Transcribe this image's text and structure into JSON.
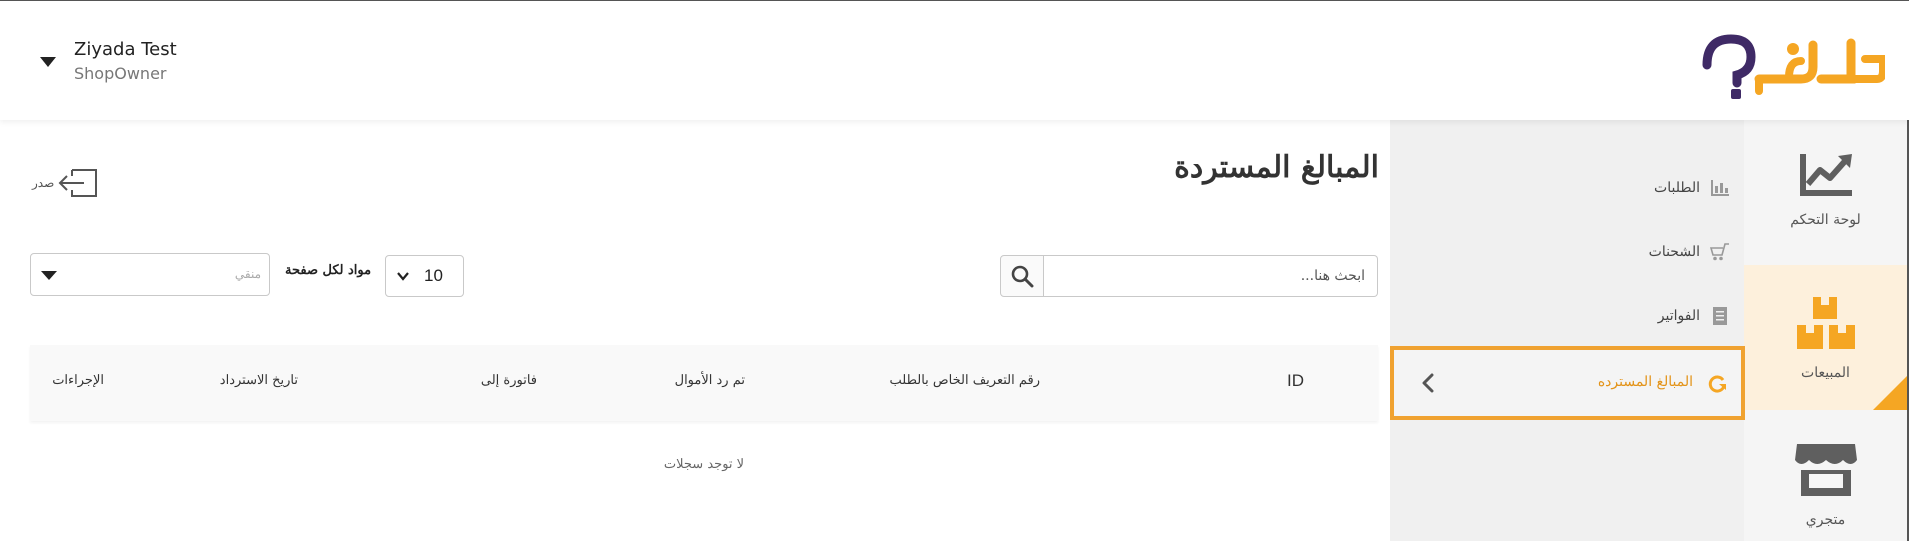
{
  "header": {
    "user_name": "Ziyada Test",
    "user_role": "ShopOwner",
    "logo_text": "كليفا؟"
  },
  "rail": {
    "items": [
      {
        "label": "لوحة التحكم",
        "icon": "chart-trend-icon",
        "active": false
      },
      {
        "label": "المبيعات",
        "icon": "boxes-icon",
        "active": true
      },
      {
        "label": "متجري",
        "icon": "store-icon",
        "active": false
      }
    ]
  },
  "submenu": {
    "items": [
      {
        "label": "الطلبات",
        "icon": "bar-chart-icon"
      },
      {
        "label": "الشحنات",
        "icon": "cart-icon"
      },
      {
        "label": "الفواتير",
        "icon": "invoice-icon"
      }
    ],
    "active_item": {
      "label": "المبالغ المسترده",
      "icon": "refresh-icon"
    }
  },
  "main": {
    "title": "المبالغ المستردة",
    "export_label": "صدر",
    "search_placeholder": "...ابحث هنا",
    "per_page_value": "10",
    "per_page_label": "مواد لكل صفحة",
    "filter_placeholder": "منقي",
    "table": {
      "columns": [
        "ID",
        "رقم التعريف الخاص بالطلب",
        "تم رد الأموال",
        "فاتورة إلى",
        "تاريخ الاسترداد",
        "الإجراءات"
      ],
      "empty_text": "لا توجد سجلات"
    }
  },
  "colors": {
    "accent": "#f5a623",
    "accent_dark": "#e39318",
    "logo_purple": "#3f2a66"
  }
}
